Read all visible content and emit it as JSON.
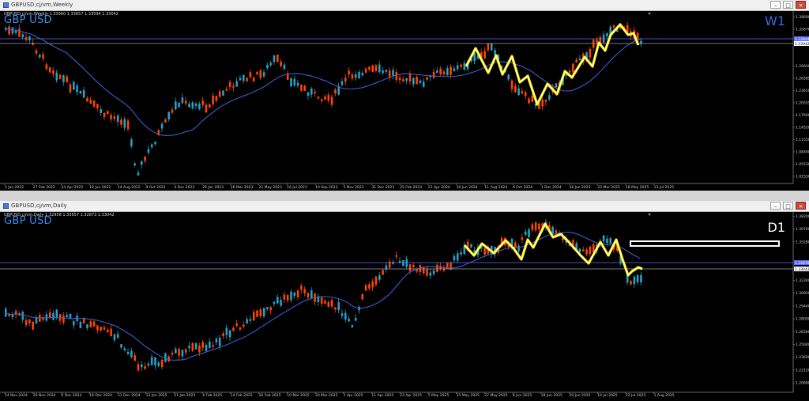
{
  "colors": {
    "bull": "#26a0c8",
    "bear": "#ff4500",
    "ma": "#3d5ccc",
    "zigzag_outer": "#ffee00",
    "zigzag_inner": "#ffffff",
    "grid_text": "#d0d0d0",
    "hline": "#5c6dff",
    "box": "#ffffff"
  },
  "windows": [
    {
      "title": "GBPUSD,cj/vm,Weekly",
      "info": "GBPUSD,cj/vm,Weekly  1.33960 1.33657 1.33594 1.33042",
      "symbol": "GBP USD",
      "timeframe": "W1",
      "timeframe_color": "#3a6ae0",
      "y_ticks": [
        "1.38690",
        "1.35676",
        "1.33944",
        "1.33042",
        "1.29640",
        "1.26585",
        "1.23610",
        "1.20555",
        "1.17600",
        "1.14520",
        "1.11550",
        "1.08490",
        "1.05530",
        "1.02550"
      ],
      "x_ticks": [
        "2 Jan 2022",
        "27 Feb 2022",
        "24 Apr 2022",
        "19 Jun 2022",
        "14 Aug 2022",
        "9 Oct 2022",
        "4 Dec 2022",
        "29 Jan 2023",
        "26 Mar 2023",
        "21 May 2023",
        "16 Jul 2023",
        "10 Sep 2023",
        "5 Nov 2023",
        "31 Dec 2023",
        "25 Feb 2024",
        "21 Apr 2024",
        "16 Jun 2024",
        "11 Aug 2024",
        "6 Oct 2024",
        "1 Dec 2024",
        "26 Jan 2025",
        "23 Mar 2025",
        "18 May 2025",
        "13 Jul 2025"
      ],
      "price_labels": [
        "1.33944",
        "1.33042"
      ]
    },
    {
      "title": "GBPUSD,cj/vm,Daily",
      "info": "GBPUSD,cj/vm,Daily  1.32958 1.33657 1.32873 1.33042",
      "symbol": "GBP USD",
      "timeframe": "D1",
      "timeframe_color": "#ffffff",
      "y_ticks": [
        "1.38200",
        "1.36760",
        "1.35280",
        "1.33678",
        "1.33042",
        "1.32340",
        "1.30920",
        "1.29440",
        "1.28000",
        "1.26560",
        "1.25040",
        "1.23600",
        "1.22120",
        "1.20680"
      ],
      "x_ticks": [
        "14 Nov 2024",
        "26 Nov 2024",
        "6 Dec 2024",
        "18 Dec 2024",
        "31 Dec 2024",
        "13 Jan 2025",
        "21 Jan 2025",
        "4 Feb 2025",
        "14 Feb 2025",
        "26 Feb 2025",
        "10 Mar 2025",
        "20 Mar 2025",
        "1 Apr 2025",
        "11 Apr 2025",
        "23 Apr 2025",
        "5 May 2025",
        "15 May 2025",
        "27 May 2025",
        "6 Jun 2025",
        "18 Jun 2025",
        "30 Jun 2025",
        "10 Jul 2025",
        "22 Jul 2025",
        "1 Aug 2025"
      ],
      "price_labels": [
        "1.33678",
        "1.33042"
      ]
    }
  ]
}
